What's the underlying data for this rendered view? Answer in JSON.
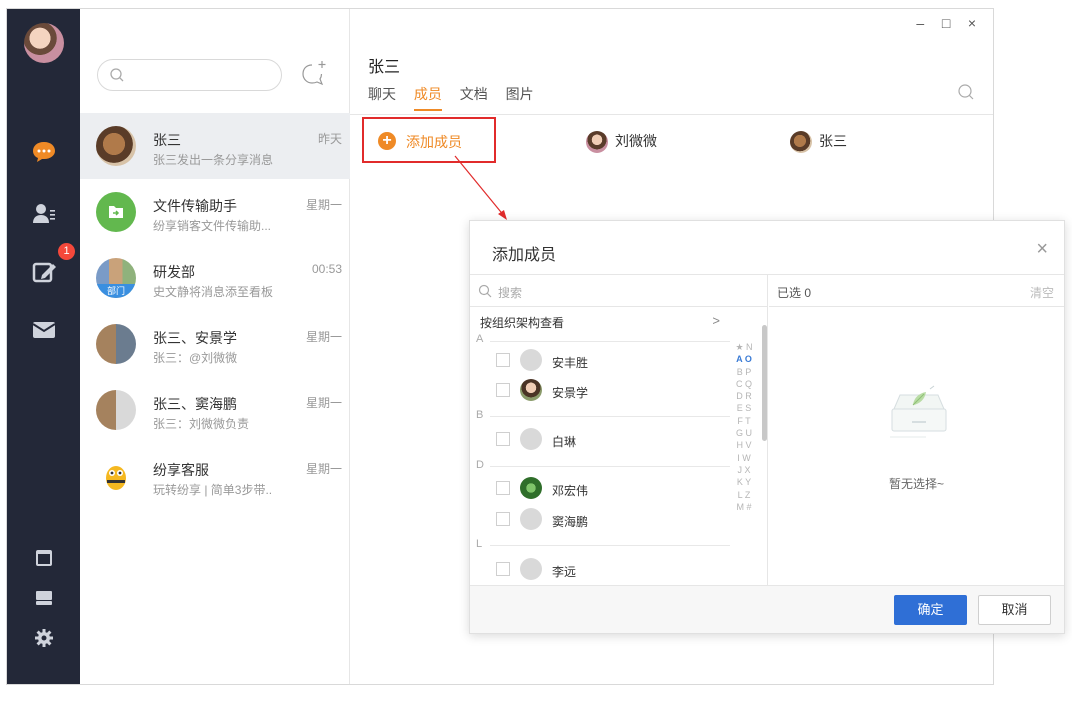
{
  "window_controls": {
    "minimize": "–",
    "maximize": "□",
    "close": "×"
  },
  "sidebar": {
    "badge_count": "1",
    "icons": [
      "chat-bubble-icon",
      "contacts-icon",
      "edit-icon",
      "mail-icon",
      "window-icon",
      "drive-icon",
      "settings-icon"
    ]
  },
  "conversations": [
    {
      "name": "张三",
      "message": "张三发出一条分享消息",
      "time": "昨天"
    },
    {
      "name": "文件传输助手",
      "message": "纷享销客文件传输助...",
      "time": "星期一"
    },
    {
      "name": "研发部",
      "message": "史文静将消息添至看板",
      "time": "00:53",
      "tag": "部门"
    },
    {
      "name": "张三、安景学",
      "message": "张三：@刘微微",
      "time": "星期一"
    },
    {
      "name": "张三、窦海鹏",
      "message": "张三：刘微微负责",
      "time": "星期一"
    },
    {
      "name": "纷享客服",
      "message": "玩转纷享 | 简单3步带..",
      "time": "星期一"
    }
  ],
  "chat": {
    "title": "张三",
    "tabs": [
      "聊天",
      "成员",
      "文档",
      "图片"
    ],
    "active_tab": "成员",
    "add_member_label": "添加成员",
    "members": [
      "刘微微",
      "张三"
    ]
  },
  "dialog": {
    "title": "添加成员",
    "close": "×",
    "search_placeholder": "搜索",
    "org_view": "按组织架构查看",
    "org_chevron": ">",
    "groups": [
      {
        "letter": "A",
        "people": [
          "安丰胜",
          "安景学"
        ]
      },
      {
        "letter": "B",
        "people": [
          "白琳"
        ]
      },
      {
        "letter": "D",
        "people": [
          "邓宏伟",
          "窦海鹏"
        ]
      },
      {
        "letter": "L",
        "people": [
          "李远"
        ]
      }
    ],
    "index_letters": [
      "★ N",
      "A O",
      "B P",
      "C Q",
      "D R",
      "E S",
      "F T",
      "G U",
      "H V",
      "I W",
      "J X",
      "K Y",
      "L Z",
      "M #"
    ],
    "selected_label": "已选 0",
    "clear_label": "清空",
    "empty_text": "暂无选择~",
    "confirm": "确定",
    "cancel": "取消"
  },
  "colors": {
    "accent": "#ef8a26",
    "primary_button": "#2f6fd6",
    "rail": "#232838",
    "highlight_border": "#e12b2b"
  }
}
